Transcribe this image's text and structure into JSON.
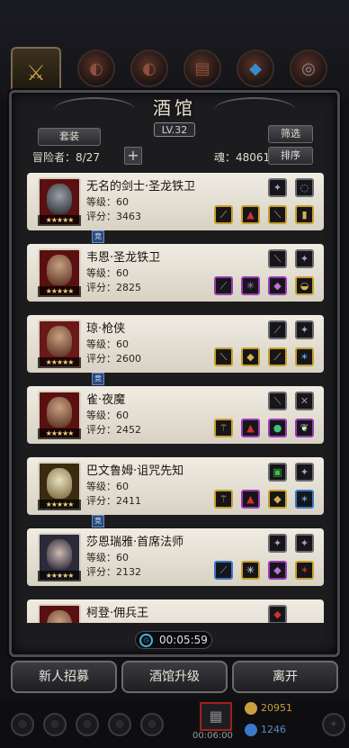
{
  "header": {
    "title": "酒馆",
    "level": "LV.32"
  },
  "toolbar": {
    "set_label": "套装",
    "filter_label": "筛选",
    "sort_label": "排序",
    "adventurers": "冒险者：8/27",
    "soul": "魂：48061"
  },
  "heroes": [
    {
      "name": "无名的剑士·圣龙铁卫",
      "level": "等级：60",
      "score": "评分：3463",
      "stars": "★★★★★"
    },
    {
      "name": "韦恩·圣龙铁卫",
      "level": "等级：60",
      "score": "评分：2825",
      "stars": "★★★★★"
    },
    {
      "name": "琼·枪侠",
      "level": "等级：60",
      "score": "评分：2600",
      "stars": "★★★★★"
    },
    {
      "name": "雀·夜魔",
      "level": "等级：60",
      "score": "评分：2452",
      "stars": "★★★★★"
    },
    {
      "name": "巴文鲁姆·诅咒先知",
      "level": "等级：60",
      "score": "评分：2411",
      "stars": "★★★★★"
    },
    {
      "name": "莎恩瑞雅·首席法师",
      "level": "等级：60",
      "score": "评分：2132",
      "stars": "★★★★★"
    },
    {
      "name": "柯登·佣兵王",
      "level": "",
      "score": "",
      "stars": ""
    }
  ],
  "bond_badge": "竞",
  "timer": "00:05:59",
  "bottom_buttons": {
    "recruit": "新人招募",
    "upgrade": "酒馆升级",
    "leave": "离开"
  },
  "footer": {
    "chest_timer": "00:06:00",
    "gold": "20951",
    "gems": "1246"
  },
  "colors": {
    "gold": "#c8a02a",
    "purple": "#9a3ab8",
    "blue": "#3a78c8",
    "card": "#ece8de"
  }
}
